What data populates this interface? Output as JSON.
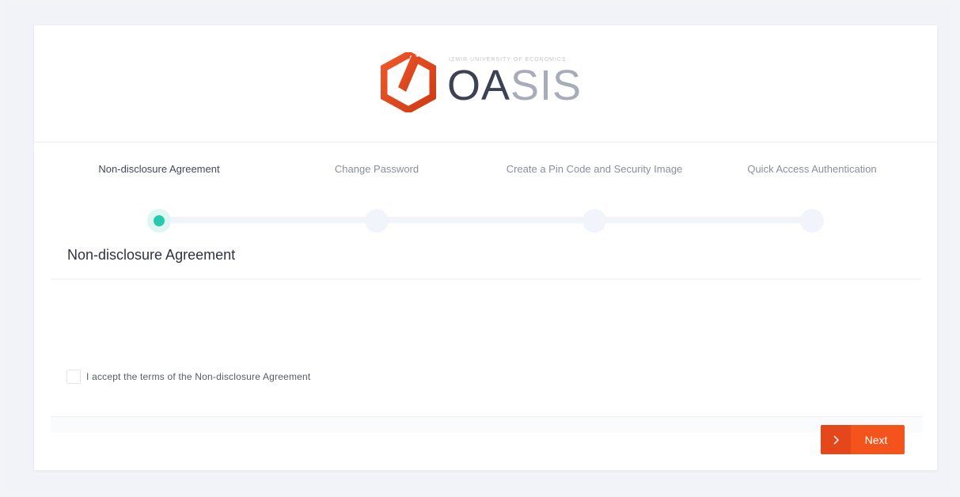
{
  "logo": {
    "university": "IZMIR UNIVERSITY OF ECONOMICS",
    "wordmark_dark": "OA",
    "wordmark_light": "SIS",
    "mark_icon": "hexagon-slash-logo-icon",
    "brand_color": "#e84a1c"
  },
  "stepper": {
    "steps": [
      {
        "label": "Non-disclosure Agreement",
        "active": true
      },
      {
        "label": "Change Password",
        "active": false
      },
      {
        "label": "Create a Pin Code and Security Image",
        "active": false
      },
      {
        "label": "Quick Access Authentication",
        "active": false
      }
    ],
    "active_color": "#26c9b0"
  },
  "section": {
    "title": "Non-disclosure Agreement"
  },
  "accept": {
    "label": "I accept the terms of the Non-disclosure Agreement",
    "checked": false
  },
  "footer": {
    "next_label": "Next",
    "next_icon": "chevron-right-icon",
    "button_color": "#f4541c"
  }
}
